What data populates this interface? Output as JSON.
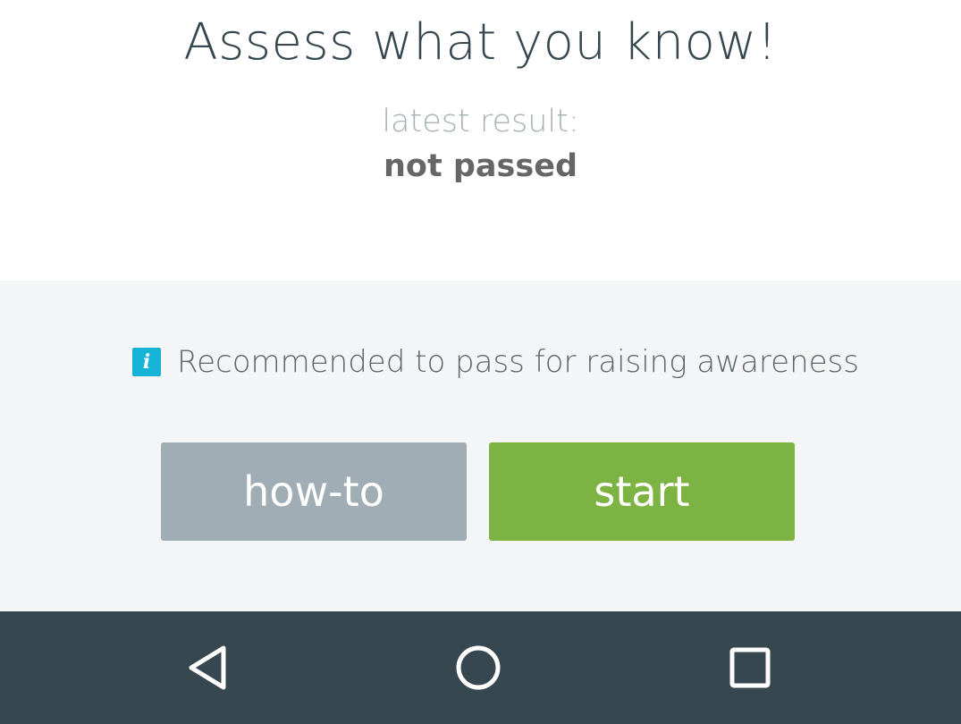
{
  "header": {
    "title": "Assess what you know!",
    "latest_result_label": "latest result:",
    "latest_result_value": "not passed"
  },
  "info": {
    "icon": "info-icon",
    "icon_glyph": "i",
    "text": "Recommended to pass for raising awareness"
  },
  "buttons": {
    "howto_label": "how-to",
    "start_label": "start"
  },
  "nav_bar": {
    "items": [
      {
        "name": "back",
        "icon": "back-triangle-icon"
      },
      {
        "name": "home",
        "icon": "home-circle-icon"
      },
      {
        "name": "recents",
        "icon": "recents-square-icon"
      }
    ]
  },
  "colors": {
    "title_text": "#37474f",
    "info_icon_bg": "#16b3d6",
    "howto_button": "#a0adb5",
    "start_button": "#7cb342",
    "nav_bar_bg": "#37474f",
    "mid_section_bg": "#f4f5f7"
  }
}
